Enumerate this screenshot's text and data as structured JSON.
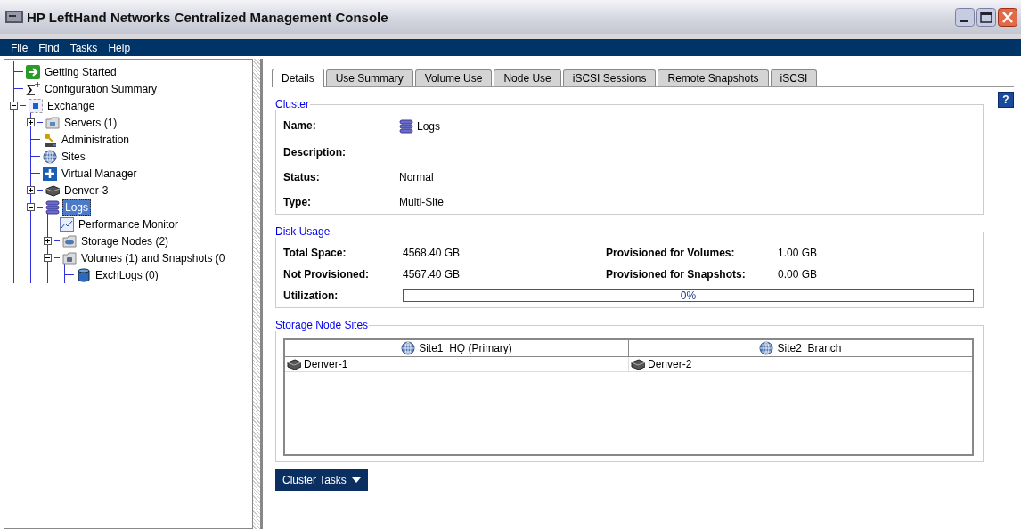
{
  "window": {
    "title": "HP LeftHand Networks Centralized Management Console"
  },
  "menu": [
    {
      "label": "File"
    },
    {
      "label": "Find"
    },
    {
      "label": "Tasks"
    },
    {
      "label": "Help"
    }
  ],
  "tree": [
    {
      "label": "Getting Started",
      "kind": "start",
      "selected": false
    },
    {
      "label": "Configuration Summary",
      "kind": "sigma",
      "selected": false
    },
    {
      "label": "Exchange",
      "kind": "group",
      "selected": false,
      "expanded": true,
      "children": [
        {
          "label": "Servers (1)",
          "kind": "servers",
          "selected": false,
          "expanded": false
        },
        {
          "label": "Administration",
          "kind": "admin",
          "selected": false
        },
        {
          "label": "Sites",
          "kind": "globe",
          "selected": false
        },
        {
          "label": "Virtual Manager",
          "kind": "manager",
          "selected": false
        },
        {
          "label": "Denver-3",
          "kind": "node",
          "selected": false,
          "expanded": false
        },
        {
          "label": "Logs",
          "kind": "cluster",
          "selected": true,
          "expanded": true,
          "children": [
            {
              "label": "Performance Monitor",
              "kind": "monitor",
              "selected": false
            },
            {
              "label": "Storage Nodes (2)",
              "kind": "nodes",
              "selected": false,
              "expanded": false
            },
            {
              "label": "Volumes (1) and Snapshots (0",
              "kind": "volumes",
              "selected": false,
              "expanded": true,
              "children": [
                {
                  "label": "ExchLogs (0)",
                  "kind": "volume",
                  "selected": false
                }
              ]
            }
          ]
        }
      ]
    }
  ],
  "tabs": [
    {
      "label": "Details",
      "selected": true
    },
    {
      "label": "Use Summary",
      "selected": false
    },
    {
      "label": "Volume Use",
      "selected": false
    },
    {
      "label": "Node Use",
      "selected": false
    },
    {
      "label": "iSCSI Sessions",
      "selected": false
    },
    {
      "label": "Remote Snapshots",
      "selected": false
    },
    {
      "label": "iSCSI",
      "selected": false
    }
  ],
  "help_button": {
    "label": "?"
  },
  "cluster": {
    "title": "Cluster",
    "fields": [
      {
        "label": "Name:",
        "value": "Logs",
        "kind": "cluster"
      },
      {
        "label": "Description:"
      },
      {
        "label": "Status:",
        "value": "Normal"
      },
      {
        "label": "Type:",
        "value": "Multi-Site"
      }
    ]
  },
  "disk_usage": {
    "title": "Disk Usage",
    "rows": [
      {
        "label": "Total Space:",
        "value": "4568.40 GB",
        "label_2": "Provisioned for Volumes:",
        "value_2": "1.00 GB"
      },
      {
        "label": "Not Provisioned:",
        "value": "4567.40 GB",
        "label_2": "Provisioned for Snapshots:",
        "value_2": "0.00 GB"
      }
    ],
    "utilization": {
      "label": "Utilization:",
      "level": 0,
      "reading": "0%"
    }
  },
  "storage_node_sites": {
    "title": "Storage Node Sites",
    "columns": [
      {
        "label": "Site1_HQ (Primary)"
      },
      {
        "label": "Site2_Branch"
      }
    ],
    "rows": [
      [
        "Denver-1",
        "Denver-2"
      ]
    ]
  },
  "cluster_tasks_button": {
    "label": "Cluster Tasks"
  }
}
